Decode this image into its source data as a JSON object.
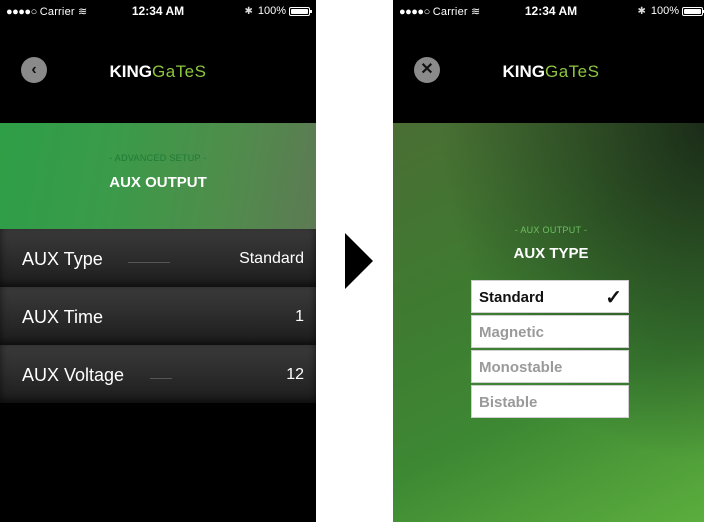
{
  "status": {
    "carrier": "Carrier",
    "time": "12:34 AM",
    "battery": "100%"
  },
  "left": {
    "nav_icon": "chevron-left-icon",
    "logo_bold": "KING",
    "logo_light": "GaTeS",
    "hero_sub": "- ADVANCED SETUP -",
    "hero_title": "AUX OUTPUT",
    "rows": [
      {
        "label": "AUX Type",
        "value": "Standard"
      },
      {
        "label": "AUX Time",
        "value": "1"
      },
      {
        "label": "AUX Voltage",
        "value": "12"
      }
    ]
  },
  "right": {
    "nav_icon": "close-icon",
    "logo_bold": "KING",
    "logo_light": "GaTeS",
    "sub": "- AUX OUTPUT -",
    "title": "AUX TYPE",
    "options": [
      "Standard",
      "Magnetic",
      "Monostable",
      "Bistable"
    ],
    "selected": "Standard"
  },
  "colors": {
    "accent_green": "#8dc63f",
    "hero_green": "#2e9e47"
  }
}
